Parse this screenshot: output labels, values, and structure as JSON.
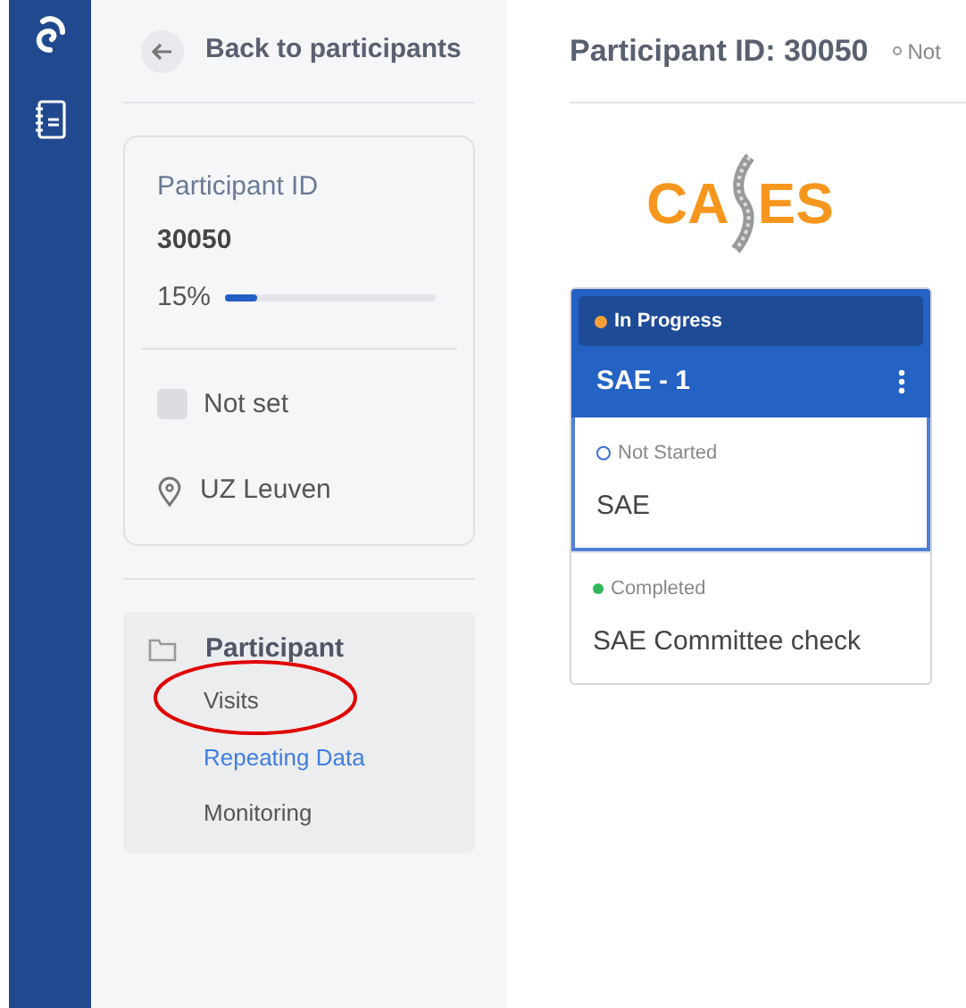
{
  "back_link": {
    "label": "Back to participants"
  },
  "participant_card": {
    "label": "Participant ID",
    "id": "30050",
    "progress": {
      "reading": "15%",
      "level": 0.15
    },
    "status": {
      "label": "Not set",
      "checked": false
    },
    "site": "UZ Leuven"
  },
  "nav": {
    "title": "Participant",
    "items": [
      {
        "label": "Visits",
        "selected": false
      },
      {
        "label": "Repeating Data",
        "selected": true
      },
      {
        "label": "Monitoring",
        "selected": false
      }
    ]
  },
  "header": {
    "title": "Participant ID: 30050",
    "status": "Not"
  },
  "logo": {
    "left": "CA",
    "right": "ES"
  },
  "visit": {
    "status": {
      "label": "In Progress",
      "color": "#f5a13a"
    },
    "title": "SAE - 1",
    "forms": [
      {
        "status": "Not Started",
        "color": "#3b6fd6",
        "kind": "hollow",
        "name": "SAE",
        "selected": true
      },
      {
        "status": "Completed",
        "color": "#2fb85a",
        "kind": "filled",
        "name": "SAE Committee check",
        "selected": false
      }
    ]
  }
}
